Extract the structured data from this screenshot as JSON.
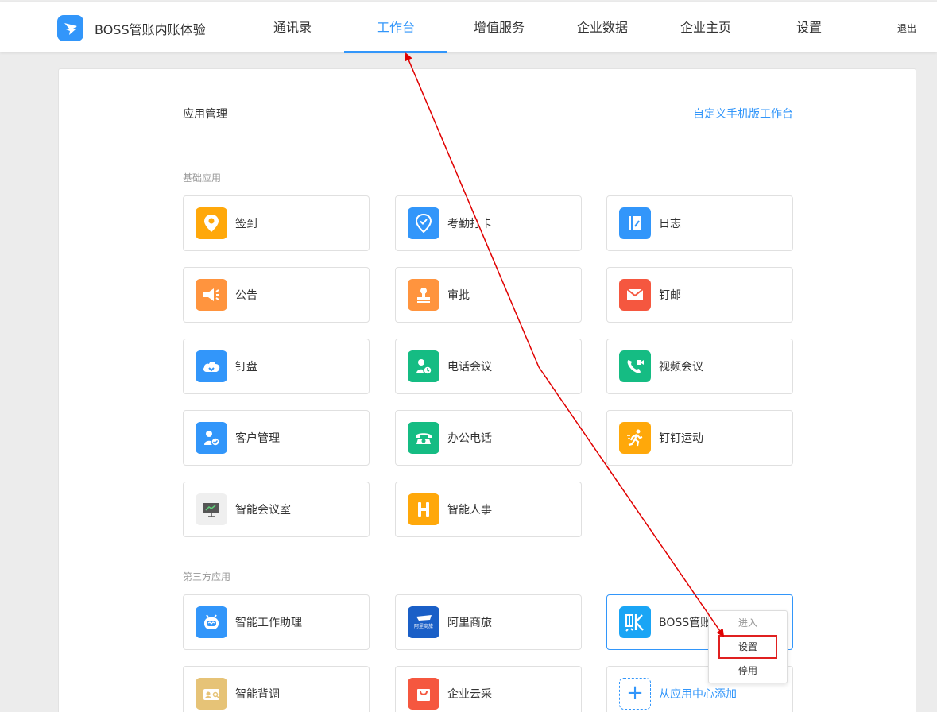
{
  "header": {
    "brand": "BOSS管账内账体验",
    "nav": [
      {
        "label": "通讯录",
        "active": false
      },
      {
        "label": "工作台",
        "active": true
      },
      {
        "label": "增值服务",
        "active": false
      },
      {
        "label": "企业数据",
        "active": false
      },
      {
        "label": "企业主页",
        "active": false
      },
      {
        "label": "设置",
        "active": false
      }
    ],
    "logout": "退出"
  },
  "main": {
    "title": "应用管理",
    "customize_link": "自定义手机版工作台",
    "basic": {
      "title": "基础应用",
      "apps": [
        {
          "label": "签到",
          "icon": "location-pin-icon",
          "color": "#ffa80a"
        },
        {
          "label": "考勤打卡",
          "icon": "clock-check-icon",
          "color": "#3296fa"
        },
        {
          "label": "日志",
          "icon": "notebook-icon",
          "color": "#3296fa"
        },
        {
          "label": "公告",
          "icon": "megaphone-icon",
          "color": "#ff943e"
        },
        {
          "label": "审批",
          "icon": "stamp-icon",
          "color": "#ff943e"
        },
        {
          "label": "钉邮",
          "icon": "envelope-icon",
          "color": "#f5573f"
        },
        {
          "label": "钉盘",
          "icon": "cloud-icon",
          "color": "#3296fa"
        },
        {
          "label": "电话会议",
          "icon": "phone-conference-icon",
          "color": "#15bc83"
        },
        {
          "label": "视频会议",
          "icon": "video-call-icon",
          "color": "#15bc83"
        },
        {
          "label": "客户管理",
          "icon": "customer-icon",
          "color": "#3296fa"
        },
        {
          "label": "办公电话",
          "icon": "telephone-icon",
          "color": "#15bc83"
        },
        {
          "label": "钉钉运动",
          "icon": "running-icon",
          "color": "#ffa80a"
        },
        {
          "label": "智能会议室",
          "icon": "presentation-board-icon",
          "color": "#efefef"
        },
        {
          "label": "智能人事",
          "icon": "h-letter-icon",
          "color": "#ffa80a"
        }
      ]
    },
    "third": {
      "title": "第三方应用",
      "apps": [
        {
          "label": "智能工作助理",
          "icon": "robot-icon",
          "color": "#3296fa"
        },
        {
          "label": "阿里商旅",
          "icon": "alitrip-logo-icon",
          "color": "#1a5fc7"
        },
        {
          "label": "BOSS管账",
          "icon": "zhang-letter-icon",
          "color": "#1aa5f5"
        },
        {
          "label": "智能背调",
          "icon": "id-card-icon",
          "color": "#e6c377"
        },
        {
          "label": "企业云采",
          "icon": "shopping-bag-icon",
          "color": "#f5573f"
        }
      ],
      "add_label": "从应用中心添加"
    },
    "context_menu": {
      "items": [
        "进入",
        "设置",
        "停用"
      ]
    }
  }
}
